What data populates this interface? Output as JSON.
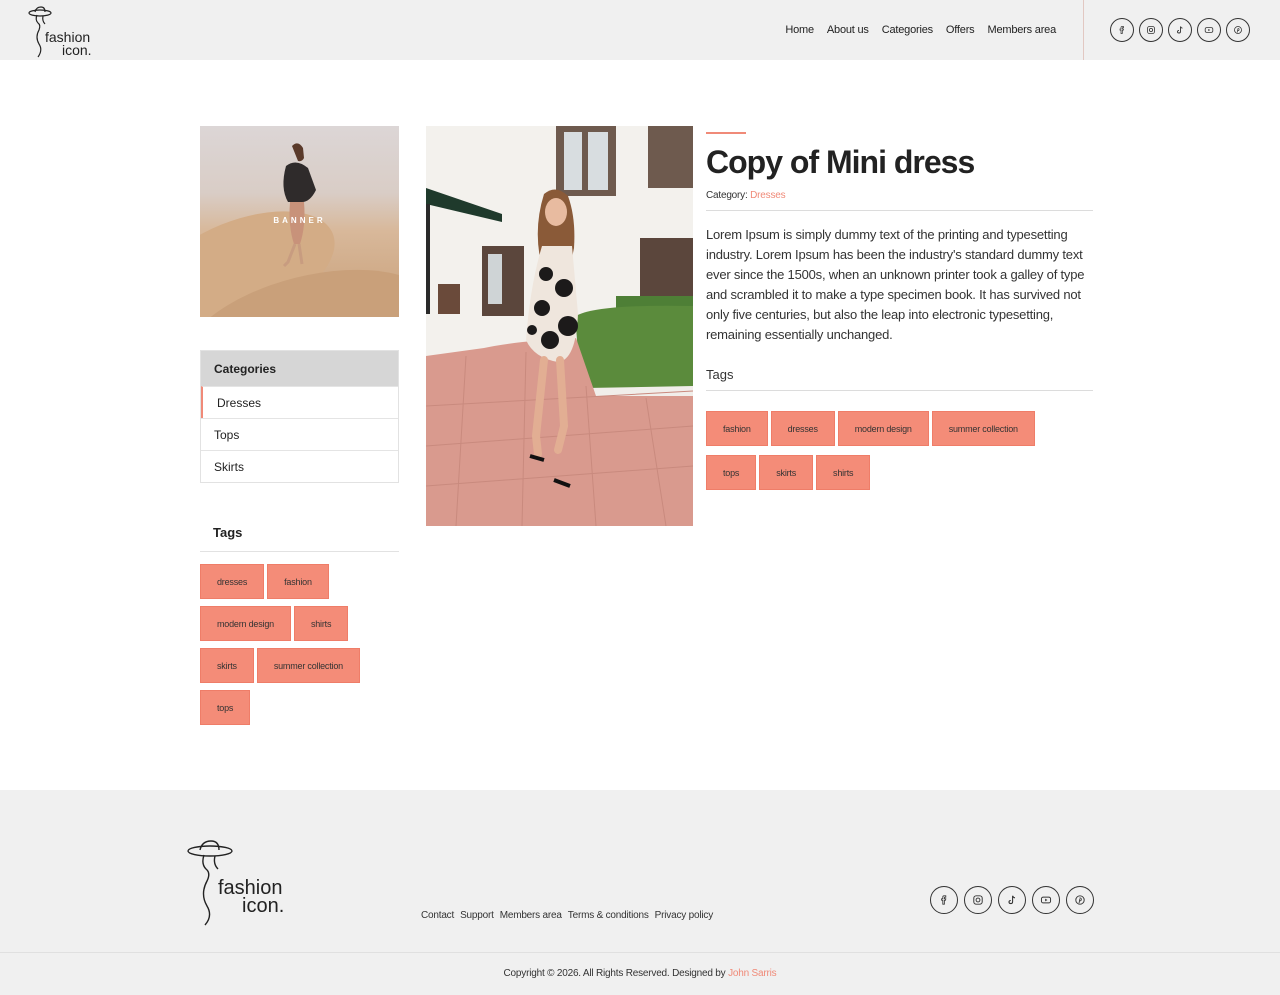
{
  "brand": {
    "line1": "fashion",
    "line2": "icon."
  },
  "nav": [
    "Home",
    "About us",
    "Categories",
    "Offers",
    "Members area"
  ],
  "social_icons": [
    "facebook-icon",
    "instagram-icon",
    "tiktok-icon",
    "youtube-icon",
    "pinterest-icon"
  ],
  "sidebar": {
    "banner_label": "BANNER",
    "categories_title": "Categories",
    "categories": [
      "Dresses",
      "Tops",
      "Skirts"
    ],
    "tags_title": "Tags",
    "tags": [
      "dresses",
      "fashion",
      "modern design",
      "shirts",
      "skirts",
      "summer collection",
      "tops"
    ]
  },
  "product": {
    "title": "Copy of Mini dress",
    "category_label": "Category:",
    "category_value": "Dresses",
    "description": "Lorem Ipsum is simply dummy text of the printing and typesetting industry. Lorem Ipsum has been the industry's standard dummy text ever since the 1500s, when an unknown printer took a galley of type and scrambled it to make a type specimen book. It has survived not only five centuries, but also the leap into electronic typesetting, remaining essentially unchanged.",
    "tags_label": "Tags",
    "tags": [
      "fashion",
      "dresses",
      "modern design",
      "summer collection",
      "tops",
      "skirts",
      "shirts"
    ]
  },
  "footer": {
    "links": [
      "Contact",
      "Support",
      "Members area",
      "Terms & conditions",
      "Privacy policy"
    ],
    "copyright_text": "Copyright © 2026. All Rights Reserved. Designed by",
    "designer": "John Sarris"
  },
  "colors": {
    "accent": "#f08a78",
    "tag_bg": "#f48c78",
    "header_bg": "#f0f0f0"
  }
}
